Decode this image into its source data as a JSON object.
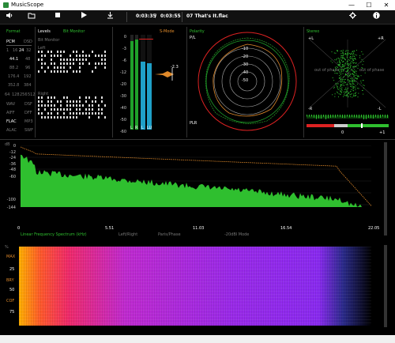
{
  "window": {
    "title": "MusicScope",
    "minimize": "—",
    "maximize": "☐",
    "close": "✕"
  },
  "toolbar": {
    "time_current": "0:03:35",
    "time_separator": "/",
    "time_total": "0:03:55",
    "track": "07 That's It.flac",
    "icons": [
      "speaker-icon",
      "folder-icon",
      "stop-icon",
      "play-icon",
      "export-icon",
      "settings-icon",
      "info-icon"
    ]
  },
  "format": {
    "label": "Format",
    "pcm": "PCM",
    "dsd": "DSD",
    "bits": [
      "1",
      "16",
      "24",
      "32"
    ],
    "rates": [
      [
        "44.1",
        "48"
      ],
      [
        "88.2",
        "96"
      ],
      [
        "176.4",
        "192"
      ],
      [
        "352.8",
        "384"
      ]
    ],
    "dsd_rates": [
      "64",
      "128",
      "256",
      "512"
    ],
    "containers": [
      [
        "WAV",
        "DSF"
      ],
      [
        "AIFF",
        "DFF"
      ],
      [
        "FLAC",
        "MP3"
      ],
      [
        "ALAC",
        "SWF"
      ]
    ]
  },
  "levels": {
    "label": "Levels",
    "bit_monitor": "Bit Monitor",
    "sub_label": "Bit Monitor",
    "left": "Left",
    "right": "Right"
  },
  "meters": {
    "s_mode": "S-Mode",
    "scale": [
      "0",
      "-3",
      "-6",
      "-12",
      "-20",
      "-30",
      "-40",
      "-50",
      "-60"
    ],
    "peak_readout": "-2.3",
    "bar_labels": [
      "L",
      "R",
      "L",
      "LU"
    ],
    "levels": {
      "left_peak": 0.93,
      "right_peak": 0.95,
      "loudness_left": 0.72,
      "loudness_right": 0.7
    }
  },
  "polarity": {
    "label": "Polarity",
    "top": "P/L",
    "bottom": "PLR",
    "rings": [
      "-10",
      "-20",
      "-30",
      "-40",
      "-50"
    ]
  },
  "stereo": {
    "label": "Stereo",
    "plus_l": "+L",
    "plus_r": "+R",
    "minus_r": "-R",
    "minus_l": "-L",
    "out_of_phase_left": "out of phase",
    "out_of_phase_right": "out of phase",
    "corr_zero": "0",
    "corr_one": "+1"
  },
  "spectrum": {
    "db_label": "dB",
    "y_ticks": [
      "0",
      "-12",
      "-24",
      "-36",
      "-48",
      "-60",
      "-100",
      "-144"
    ],
    "x_ticks": [
      "0",
      "5.51",
      "11.03",
      "16.54",
      "22.05"
    ],
    "x_label": "Linear Frequency Spectrum (kHz)",
    "modes": [
      "Left/Right",
      "Paris/Phase",
      "-20dBl Mode"
    ]
  },
  "spectrogram": {
    "pct_label": "%",
    "side_labels": [
      "MAX",
      "25",
      "BRY",
      "50",
      "COF",
      "75"
    ]
  },
  "colors": {
    "green": "#2fbf2f",
    "orange": "#e08a2a",
    "cyan": "#1fa0c8",
    "red": "#d22"
  }
}
